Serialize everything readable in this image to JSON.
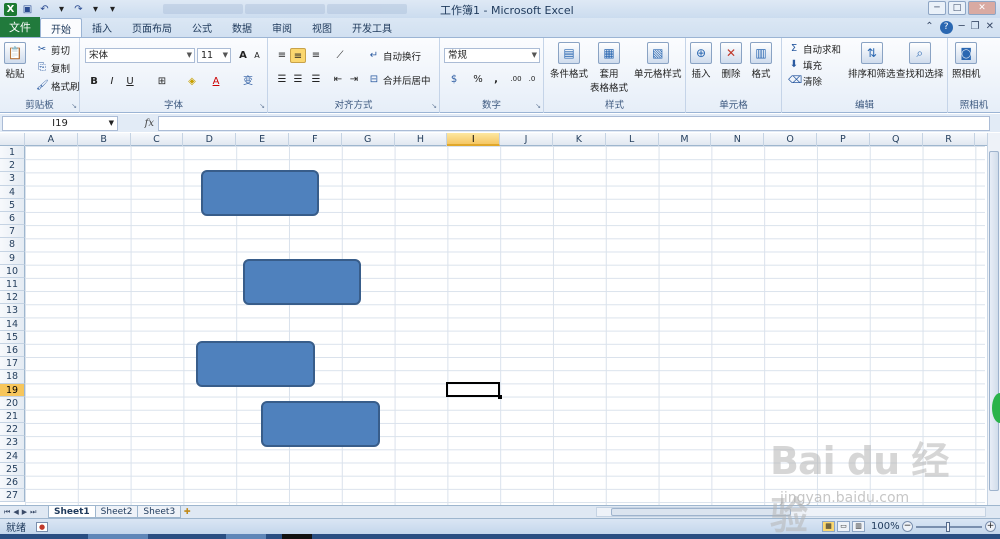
{
  "window": {
    "title": "工作簿1 - Microsoft Excel",
    "buttons": [
      "─",
      "□",
      "✕"
    ]
  },
  "quick_access": {
    "undo_dd": "▾",
    "redo_dd": "▾",
    "customize": "▾"
  },
  "tabs": {
    "file": "文件",
    "items": [
      "开始",
      "插入",
      "页面布局",
      "公式",
      "数据",
      "审阅",
      "视图",
      "开发工具"
    ],
    "active": "开始"
  },
  "ribbon": {
    "clipboard": {
      "label": "剪贴板",
      "paste": "粘贴",
      "cut": "剪切",
      "copy": "复制",
      "format_painter": "格式刷"
    },
    "font": {
      "label": "字体",
      "font_name": "宋体",
      "font_size": "11",
      "bold": "B",
      "italic": "I",
      "underline": "U",
      "grow": "A",
      "shrink": "A",
      "font_color": "A",
      "phonetic": "变"
    },
    "alignment": {
      "label": "对齐方式",
      "wrap_text": "自动换行",
      "merge_center": "合并后居中"
    },
    "number": {
      "label": "数字",
      "format": "常规",
      "percent": "%",
      "comma": ",",
      "inc_decimal": ".00",
      "dec_decimal": ".0"
    },
    "styles": {
      "label": "样式",
      "conditional": "条件格式",
      "as_table_1": "套用",
      "as_table_2": "表格格式",
      "cell_styles": "单元格样式"
    },
    "cells": {
      "label": "单元格",
      "insert": "插入",
      "delete": "删除",
      "format": "格式"
    },
    "editing": {
      "label": "编辑",
      "autosum": "自动求和",
      "fill": "填充",
      "clear": "清除",
      "sort_filter": "排序和筛选",
      "find_select": "查找和选择"
    },
    "camera": {
      "label": "照相机",
      "camera": "照相机"
    }
  },
  "formula_bar": {
    "name_box": "I19",
    "fx": "fx",
    "formula": ""
  },
  "sheet": {
    "columns": [
      "A",
      "B",
      "C",
      "D",
      "E",
      "F",
      "G",
      "H",
      "I",
      "J",
      "K",
      "L",
      "M",
      "N",
      "O",
      "P",
      "Q",
      "R"
    ],
    "rows": [
      "1",
      "2",
      "3",
      "4",
      "5",
      "6",
      "7",
      "8",
      "9",
      "10",
      "11",
      "12",
      "13",
      "14",
      "15",
      "16",
      "17",
      "18",
      "19",
      "20",
      "21",
      "22",
      "23",
      "24",
      "25",
      "26",
      "27"
    ],
    "selected_column": "I",
    "selected_row": "19",
    "shape_color": "#4f81bd",
    "shape_count": 4
  },
  "sheet_tabs": {
    "tabs": [
      "Sheet1",
      "Sheet2",
      "Sheet3"
    ],
    "active": "Sheet1"
  },
  "status_bar": {
    "status": "就绪",
    "zoom": "100%"
  },
  "watermark": {
    "logo": "Bai du 经验",
    "url": "jingyan.baidu.com"
  },
  "colors": {
    "file_tab": "#217a3c",
    "accent": "#4f81bd",
    "selection": "#f5c765"
  }
}
